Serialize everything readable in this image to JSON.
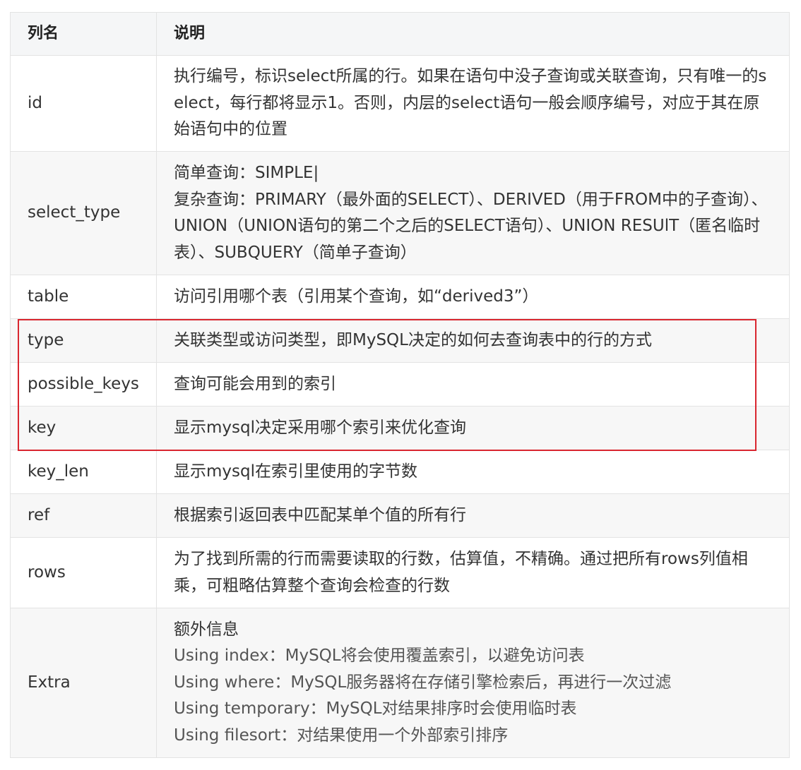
{
  "table": {
    "headers": [
      "列名",
      "说明"
    ],
    "rows": [
      {
        "name": "id",
        "lines": [
          "执行编号，标识select所属的行。如果在语句中没子查询或关联查询，只有唯一的select，每行都将显示1。否则，内层的select语句一般会顺序编号，对应于其在原始语句中的位置"
        ]
      },
      {
        "name": "select_type",
        "lines": [
          "简单查询：SIMPLE|",
          "复杂查询：PRIMARY（最外面的SELECT）、DERIVED（用于FROM中的子查询）、UNION（UNION语句的第二个之后的SELECT语句）、UNION RESUlT（匿名临时表）、SUBQUERY（简单子查询）"
        ]
      },
      {
        "name": "table",
        "lines": [
          "访问引用哪个表（引用某个查询，如“derived3”）"
        ]
      },
      {
        "name": "type",
        "lines": [
          "关联类型或访问类型，即MySQL决定的如何去查询表中的行的方式"
        ]
      },
      {
        "name": "possible_keys",
        "lines": [
          "查询可能会用到的索引"
        ]
      },
      {
        "name": "key",
        "lines": [
          "显示mysql决定采用哪个索引来优化查询"
        ]
      },
      {
        "name": "key_len",
        "lines": [
          "显示mysql在索引里使用的字节数"
        ]
      },
      {
        "name": "ref",
        "lines": [
          "根据索引返回表中匹配某单个值的所有行"
        ]
      },
      {
        "name": "rows",
        "lines": [
          "为了找到所需的行而需要读取的行数，估算值，不精确。通过把所有rows列值相乘，可粗略估算整个查询会检查的行数"
        ]
      },
      {
        "name": "Extra",
        "lines": [
          "额外信息",
          "Using index：MySQL将会使用覆盖索引，以避免访问表",
          "Using where：MySQL服务器将在存储引擎检索后，再进行一次过滤",
          "Using temporary：MySQL对结果排序时会使用临时表",
          "Using filesort：对结果使用一个外部索引排序"
        ]
      }
    ]
  },
  "highlight": {
    "color": "#d9262f"
  }
}
